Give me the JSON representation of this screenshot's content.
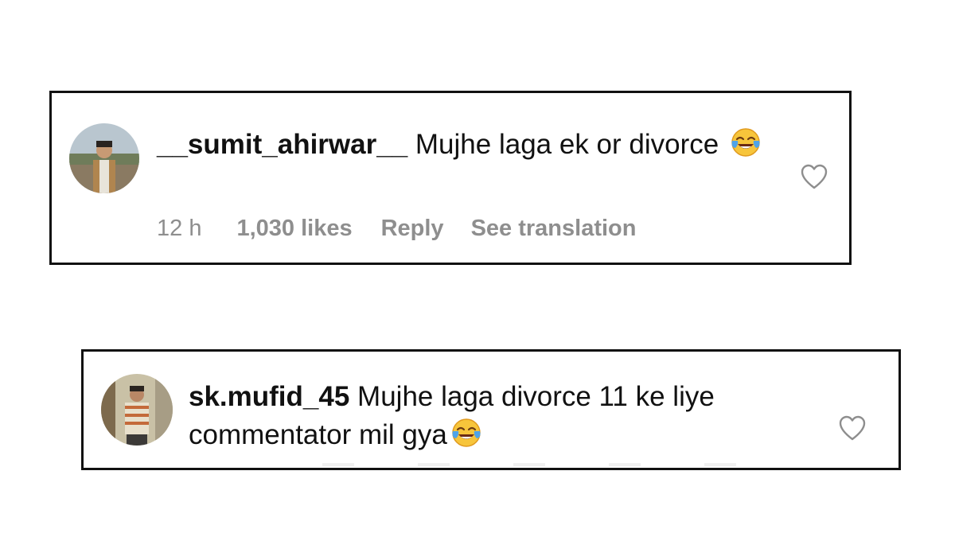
{
  "comments": [
    {
      "username": "__sumit_ahirwar__",
      "text": "Mujhe laga ek or divorce",
      "emoji": "face-with-tears-of-joy",
      "time": "12 h",
      "likes": "1,030 likes",
      "reply_label": "Reply",
      "translation_label": "See translation",
      "liked": false
    },
    {
      "username": "sk.mufid_45",
      "text": "Mujhe laga divorce 11 ke liye commentator mil gya",
      "emoji": "face-with-tears-of-joy",
      "liked": false
    }
  ],
  "colors": {
    "text": "#111111",
    "meta": "#8e8e8e",
    "border": "#111111"
  },
  "icons": {
    "like": "heart-outline-icon",
    "emoji": "tears-of-joy-emoji"
  }
}
